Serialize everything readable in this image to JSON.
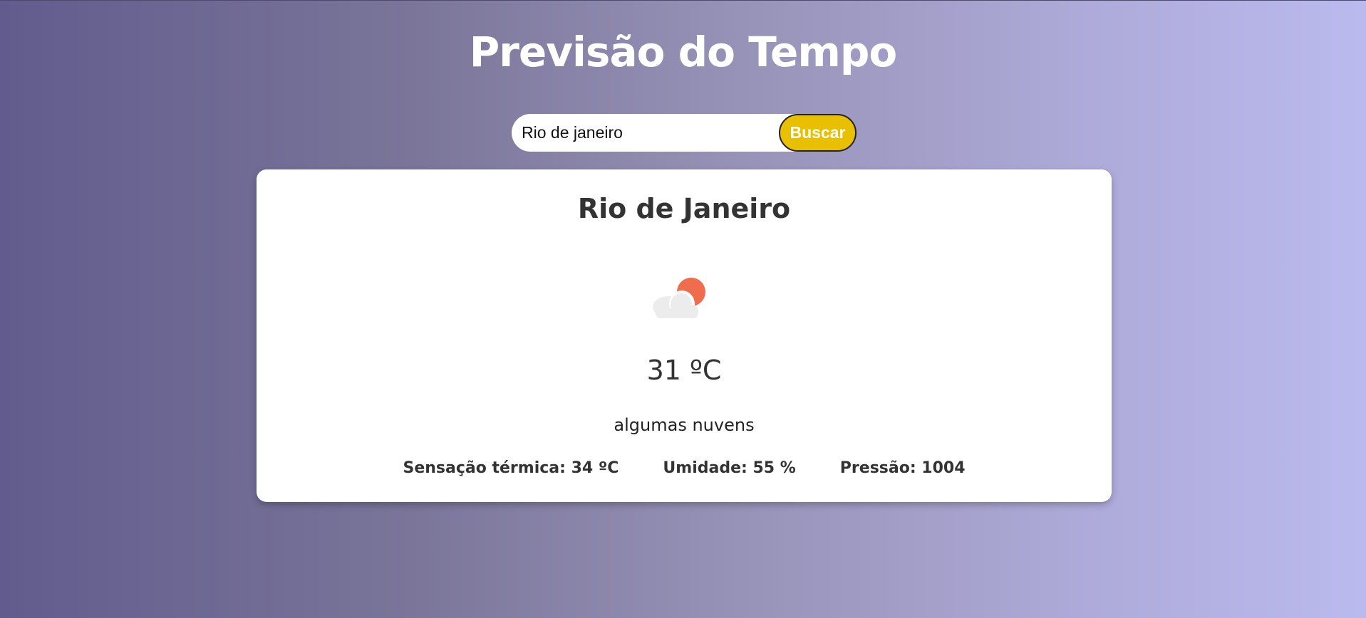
{
  "header": {
    "title": "Previsão do Tempo"
  },
  "search": {
    "value": "Rio de janeiro",
    "button_label": "Buscar"
  },
  "weather": {
    "city": "Rio de Janeiro",
    "icon": "partly-cloudy-icon",
    "temperature": "31 ºC",
    "description": "algumas nuvens",
    "details": {
      "feels_like": "Sensação térmica: 34 ºC",
      "humidity": "Umidade: 55 %",
      "pressure": "Pressão: 1004"
    }
  },
  "colors": {
    "gradient_start": "#625c8e",
    "gradient_end": "#bbbaee",
    "button": "#e9c000",
    "sun": "#ef6c4d",
    "cloud": "#ececec"
  }
}
